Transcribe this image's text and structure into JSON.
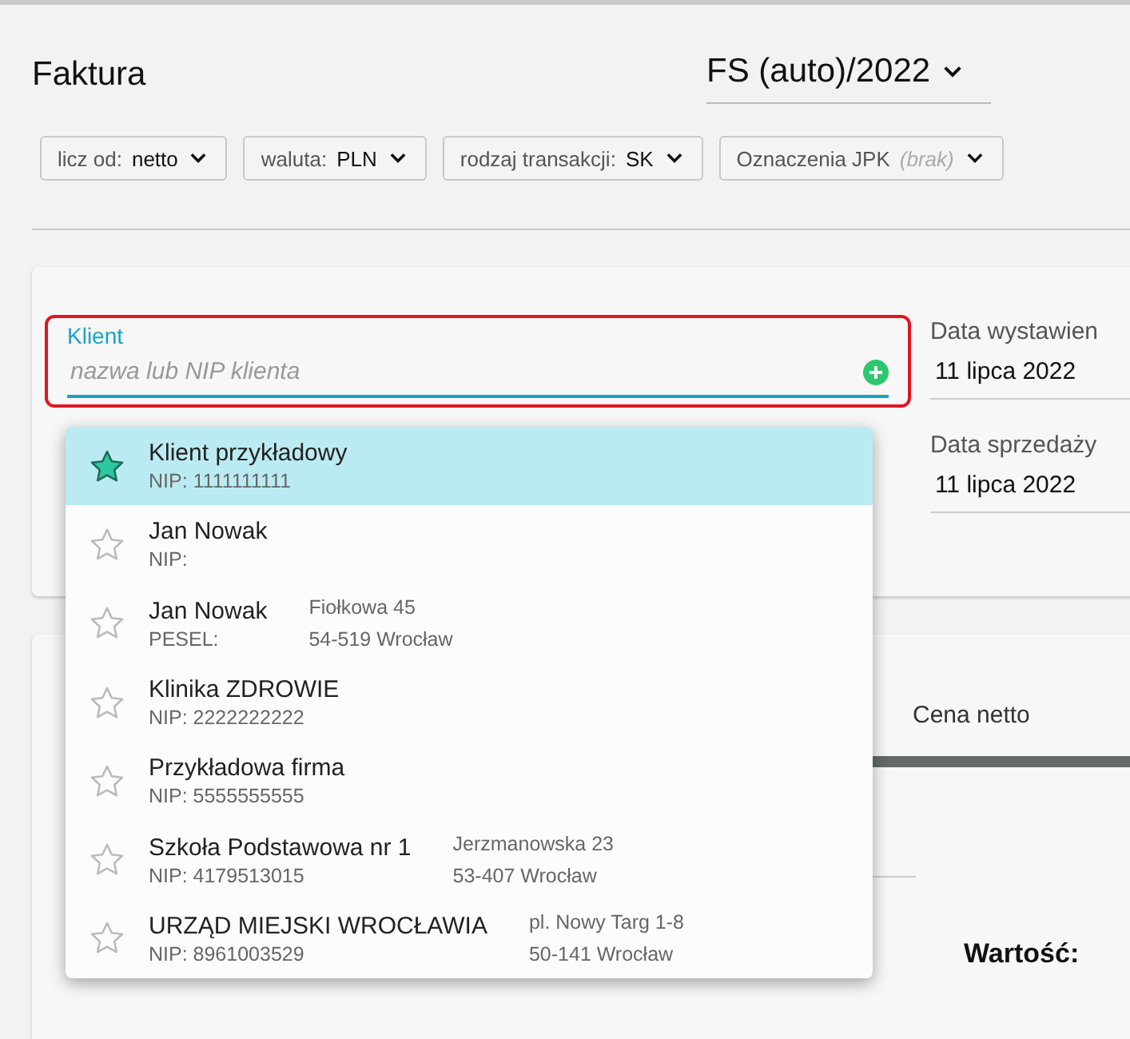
{
  "header": {
    "title": "Faktura",
    "number": "FS (auto)/2022"
  },
  "filters": [
    {
      "label": "licz od:",
      "value": "netto",
      "kind": "value"
    },
    {
      "label": "waluta:",
      "value": "PLN",
      "kind": "value"
    },
    {
      "label": "rodzaj transakcji:",
      "value": "SK",
      "kind": "value"
    },
    {
      "label": "Oznaczenia JPK",
      "value": "(brak)",
      "kind": "empty"
    }
  ],
  "client_field": {
    "label": "Klient",
    "placeholder": "nazwa lub NIP klienta",
    "focused": true
  },
  "dates": [
    {
      "label": "Data wystawien",
      "value": "11 lipca 2022"
    },
    {
      "label": "Data sprzedaży",
      "value": "11 lipca 2022"
    }
  ],
  "suggestions": [
    {
      "name": "Klient przykładowy",
      "id": "NIP: 1111111111",
      "favorite": true,
      "selected": true
    },
    {
      "name": "Jan Nowak",
      "id": "NIP:",
      "favorite": false,
      "selected": false
    },
    {
      "name": "Jan Nowak",
      "id": "PESEL:",
      "address": [
        "Fiołkowa 45",
        "54-519 Wrocław"
      ],
      "favorite": false,
      "selected": false
    },
    {
      "name": "Klinika ZDROWIE",
      "id": "NIP: 2222222222",
      "favorite": false,
      "selected": false
    },
    {
      "name": "Przykładowa firma",
      "id": "NIP: 5555555555",
      "favorite": false,
      "selected": false
    },
    {
      "name": "Szkoła Podstawowa nr 1",
      "id": "NIP: 4179513015",
      "address": [
        "Jerzmanowska 23",
        "53-407 Wrocław"
      ],
      "favorite": false,
      "selected": false
    },
    {
      "name": "URZĄD MIEJSKI WROCŁAWIA",
      "id": "NIP: 8961003529",
      "address": [
        "pl. Nowy Targ 1-8",
        "50-141 Wrocław"
      ],
      "favorite": false,
      "selected": false
    }
  ],
  "items_table": {
    "column": "Cena netto",
    "total_label": "Wartość:"
  }
}
